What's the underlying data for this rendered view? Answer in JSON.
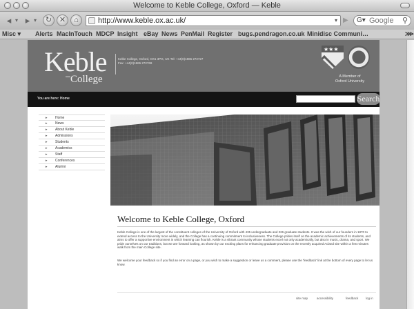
{
  "window": {
    "title": "Welcome to Keble College, Oxford — Keble"
  },
  "toolbar": {
    "back_icon": "◂",
    "dropdown_glyph": "▾",
    "forward_icon": "▸",
    "reload_icon": "↻",
    "stop_icon": "✕",
    "home_icon": "⌂",
    "url": "http://www.keble.ox.ac.uk/",
    "url_dropdown_icon": "▾",
    "feed_icon": "▶",
    "search_engine": "G▾",
    "search_placeholder": "Google",
    "search_icon": "⚲"
  },
  "bookmarks": {
    "items": [
      "Misc ▾",
      "Alerts",
      "MacInTouch",
      "MDCP",
      "Insight",
      "eBay",
      "News",
      "PenMail",
      "Register",
      "bugs.pendragon.co.uk",
      "Minidisc Communi…",
      "⋙"
    ]
  },
  "site_header": {
    "logo_main": "Keble",
    "logo_sub": "College",
    "address": "Keble College, Oxford, OX1 3PG, UK Tel: +44(0)1865 272727 Fax: +44(0)1865 272769",
    "member_line1": "A Member of",
    "member_line2": "Oxford University",
    "crest_stars": "★★★"
  },
  "location_bar": {
    "you_are_here": "You are here: Home",
    "search_button": "Search"
  },
  "nav": {
    "arrow": "▸",
    "items": [
      "Home",
      "News",
      "About Keble",
      "Admissions",
      "Students",
      "Academics",
      "Staff",
      "Conferences",
      "Alumni"
    ]
  },
  "main": {
    "title": "Welcome to Keble College, Oxford",
    "paragraph1": "Keble College is one of the largest of the constituent colleges of the University of Oxford with 435 undergraduate and 226 graduate students. It was the wish of our founders in 1870 to extend access to the University more widely, and the College has a continuing commitment to inclusiveness. The College prides itself on the academic achievements of its students, and aims to offer a supportive environment in which learning can flourish. Keble is a vibrant community whose students excel not only academically, but also in music, drama, and sport. We pride ourselves on our traditions, but we are forward looking, as shown by our exciting plans for enhancing graduate provision on the recently acquired Acland site within a few minutes walk from the main College site.",
    "paragraph2": "We welcome your feedback so if you find an error on a page, or you wish to make a suggestion or leave us a comment, please use the 'feedback' link at the bottom of every page to let us know."
  },
  "footer": {
    "links": [
      "site map",
      "accessibility",
      "feedback",
      "log in"
    ]
  }
}
